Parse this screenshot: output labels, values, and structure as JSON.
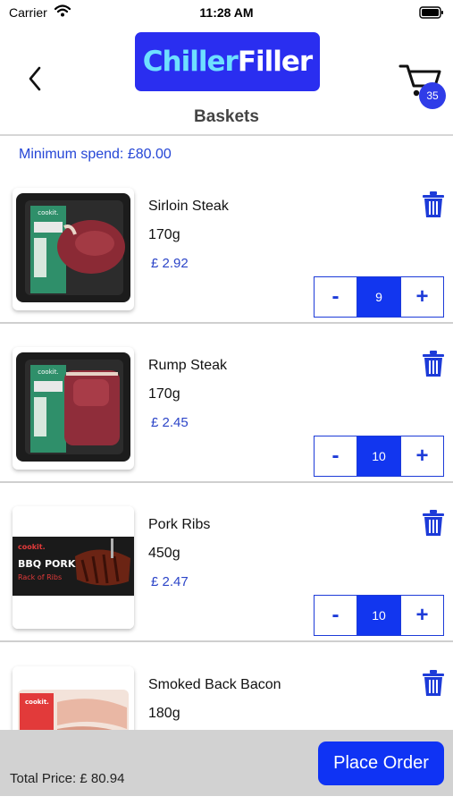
{
  "status_bar": {
    "carrier": "Carrier",
    "time": "11:28 AM"
  },
  "header": {
    "logo_part1": "Chiller",
    "logo_part2": "Filler",
    "cart_count": "35",
    "icons": {
      "back": "chevron-left-icon",
      "cart": "cart-icon"
    }
  },
  "page": {
    "title": "Baskets",
    "minimum_spend": "Minimum spend: £80.00"
  },
  "items": [
    {
      "name": "Sirloin Steak",
      "weight": "170g",
      "price": "£ 2.92",
      "quantity": "9",
      "minus_label": "-",
      "plus_label": "+",
      "image": "steak-package-image"
    },
    {
      "name": "Rump Steak",
      "weight": "170g",
      "price": "£ 2.45",
      "quantity": "10",
      "minus_label": "-",
      "plus_label": "+",
      "image": "steak-package-image"
    },
    {
      "name": "Pork Ribs",
      "weight": "450g",
      "price": "£ 2.47",
      "quantity": "10",
      "minus_label": "-",
      "plus_label": "+",
      "image": "bbq-pork-ribs-image"
    },
    {
      "name": "Smoked Back Bacon",
      "weight": "180g",
      "price": "",
      "quantity": "",
      "minus_label": "-",
      "plus_label": "+",
      "image": "bacon-package-image"
    }
  ],
  "image_labels": {
    "brand": "cookit.",
    "ribs_line1": "BBQ PORK",
    "ribs_line2": "Rack of Ribs"
  },
  "footer": {
    "total_price": "Total Price: £ 80.94",
    "place_order_label": "Place Order"
  },
  "colors": {
    "brand_blue": "#2a2ef0",
    "accent_blue": "#1236ef",
    "price_blue": "#2c45c8",
    "footer_gray": "#d2d2d2"
  }
}
